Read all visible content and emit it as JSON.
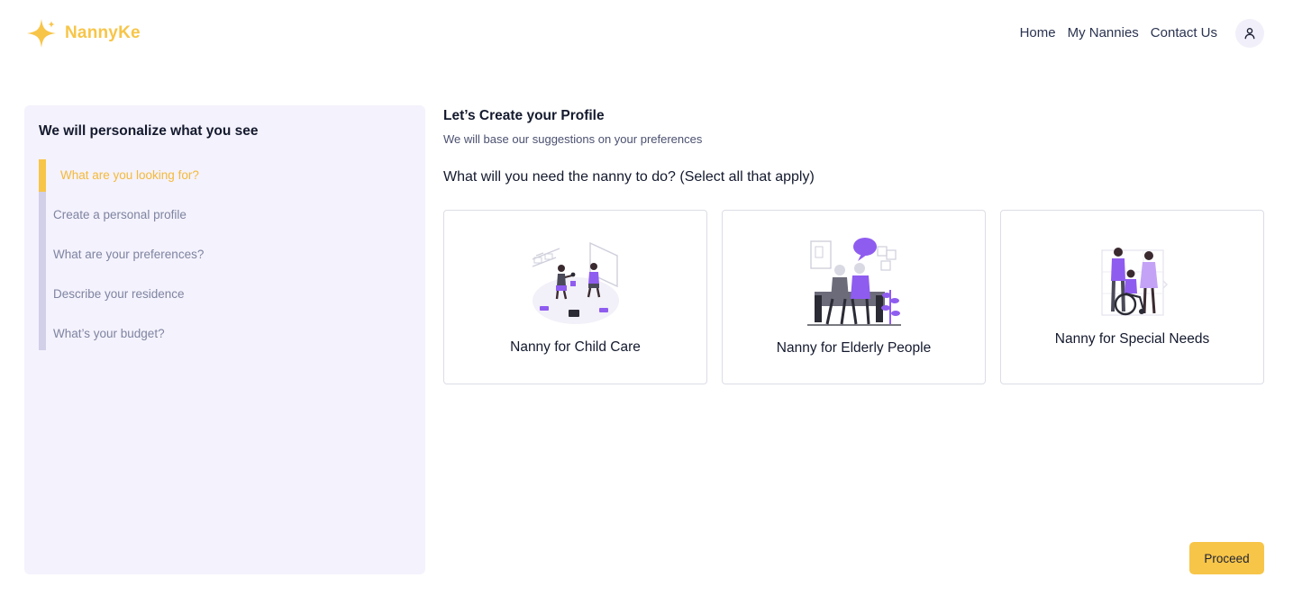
{
  "brand": {
    "name": "NannyKe",
    "icon": "sparkle-icon",
    "color": "#f7c548"
  },
  "nav": {
    "items": [
      {
        "label": "Home"
      },
      {
        "label": "My Nannies"
      },
      {
        "label": "Contact Us"
      }
    ],
    "avatar_icon": "user-icon"
  },
  "sidebar": {
    "title": "We will personalize what you see",
    "steps": [
      {
        "label": "What are you looking for?",
        "active": true
      },
      {
        "label": "Create a personal profile",
        "active": false
      },
      {
        "label": "What are your preferences?",
        "active": false
      },
      {
        "label": "Describe your residence",
        "active": false
      },
      {
        "label": "What’s your budget?",
        "active": false
      }
    ]
  },
  "main": {
    "title": "Let’s Create your Profile",
    "subtitle": "We will base our suggestions on your preferences",
    "question": "What will you need the nanny to do? (Select all that apply)",
    "options": [
      {
        "label": "Nanny for Child Care",
        "icon": "child-care-illustration"
      },
      {
        "label": "Nanny for Elderly People",
        "icon": "elderly-care-illustration"
      },
      {
        "label": "Nanny for Special Needs",
        "icon": "special-needs-illustration"
      }
    ],
    "proceed_label": "Proceed"
  },
  "colors": {
    "accent": "#f7c548",
    "illustration": "#8f5cf0",
    "sidebar_bg": "#f4f2fc"
  }
}
